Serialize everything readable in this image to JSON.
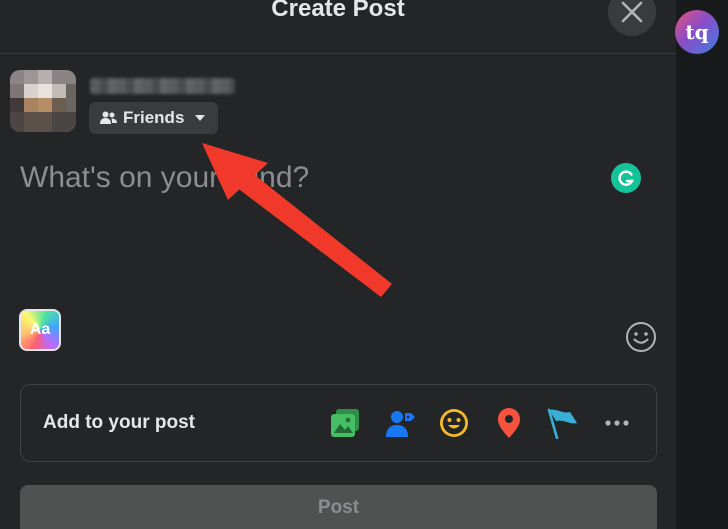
{
  "dialog": {
    "title": "Create Post"
  },
  "watermark": {
    "text": "tq"
  },
  "author": {
    "audience_label": "Friends"
  },
  "composer": {
    "placeholder": "What's on your mind?"
  },
  "text_format": {
    "label": "Aa"
  },
  "add_to_post": {
    "label": "Add to your post",
    "options": [
      {
        "icon": "photo-video-icon",
        "color": "#45bd62"
      },
      {
        "icon": "tag-people-icon",
        "color": "#1877f2"
      },
      {
        "icon": "feeling-activity-icon",
        "color": "#f7b928"
      },
      {
        "icon": "check-in-icon",
        "color": "#f5533d"
      },
      {
        "icon": "life-event-flag-icon",
        "color": "#39afd5"
      },
      {
        "icon": "more-icon",
        "color": "#b0b3b8"
      }
    ]
  },
  "post_button": {
    "label": "Post"
  },
  "colors": {
    "modal_bg": "#242526",
    "page_bg": "#18191a",
    "annotation_arrow": "#f0392b"
  }
}
